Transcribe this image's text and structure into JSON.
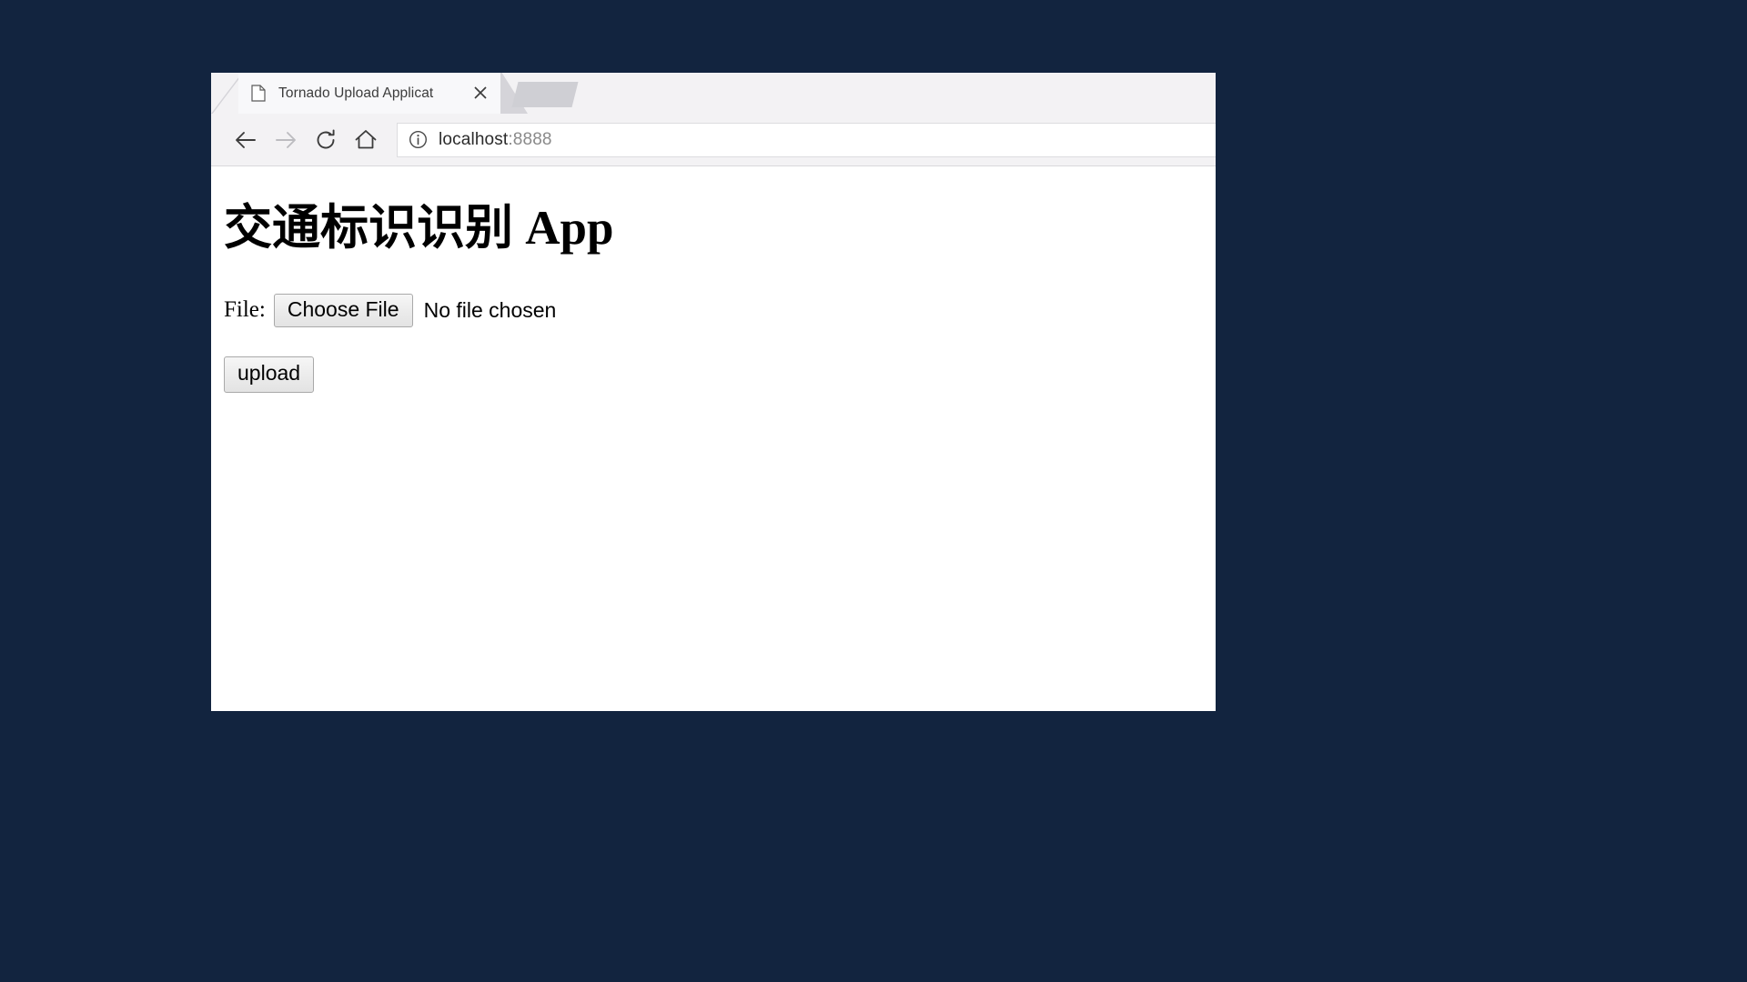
{
  "desktop": {
    "background_color": "#12243f"
  },
  "browser": {
    "tab": {
      "title": "Tornado Upload Applicat",
      "favicon_name": "page-icon",
      "close_label": "×"
    },
    "toolbar": {
      "back_label": "Back",
      "forward_label": "Forward",
      "reload_label": "Reload",
      "home_label": "Home"
    },
    "address_bar": {
      "host": "localhost",
      "port": ":8888",
      "info_icon_name": "site-info-icon"
    }
  },
  "page": {
    "heading": "交通标识识别 App",
    "file_field": {
      "label": "File:",
      "button_label": "Choose File",
      "status_text": "No file chosen"
    },
    "upload_button_label": "upload"
  }
}
